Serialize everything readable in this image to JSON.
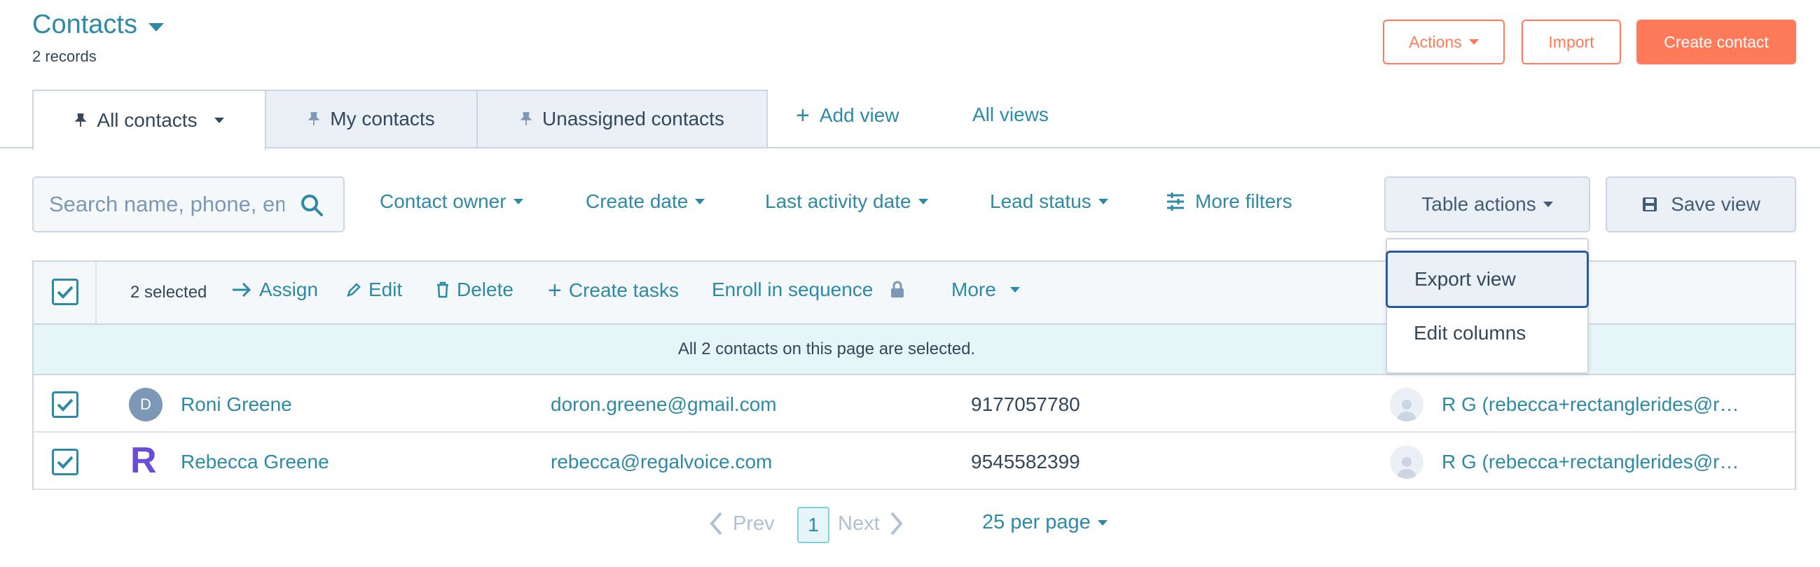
{
  "header": {
    "title": "Contacts",
    "record_count": "2 records",
    "actions_label": "Actions",
    "import_label": "Import",
    "create_label": "Create contact"
  },
  "tabs": [
    {
      "label": "All contacts"
    },
    {
      "label": "My contacts"
    },
    {
      "label": "Unassigned contacts"
    }
  ],
  "tab_links": {
    "add_view": "Add view",
    "all_views": "All views"
  },
  "search": {
    "placeholder": "Search name, phone, email"
  },
  "filters": {
    "owner": "Contact owner",
    "create_date": "Create date",
    "last_activity": "Last activity date",
    "lead_status": "Lead status",
    "more_filters": "More filters"
  },
  "table_actions": {
    "label": "Table actions",
    "save_view": "Save view",
    "menu": [
      "Export view",
      "Edit columns"
    ]
  },
  "bulk": {
    "selected": "2 selected",
    "assign": "Assign",
    "edit": "Edit",
    "delete": "Delete",
    "create_tasks": "Create tasks",
    "enroll": "Enroll in sequence",
    "more": "More",
    "banner": "All 2 contacts on this page are selected."
  },
  "rows": [
    {
      "avatar": "D",
      "name": "Roni Greene",
      "email": "doron.greene@gmail.com",
      "phone": "9177057780",
      "owner": "R G (rebecca+rectanglerides@r…"
    },
    {
      "avatar": "R",
      "name": "Rebecca Greene",
      "email": "rebecca@regalvoice.com",
      "phone": "9545582399",
      "owner": "R G (rebecca+rectanglerides@r…"
    }
  ],
  "pagination": {
    "prev": "Prev",
    "page": "1",
    "next": "Next",
    "per_page": "25 per page"
  },
  "colors": {
    "accent": "#2d8aa6",
    "brand": "#ff7a59",
    "selected_banner": "#e5f5f8",
    "logo_purple": "#6a4cd6"
  }
}
